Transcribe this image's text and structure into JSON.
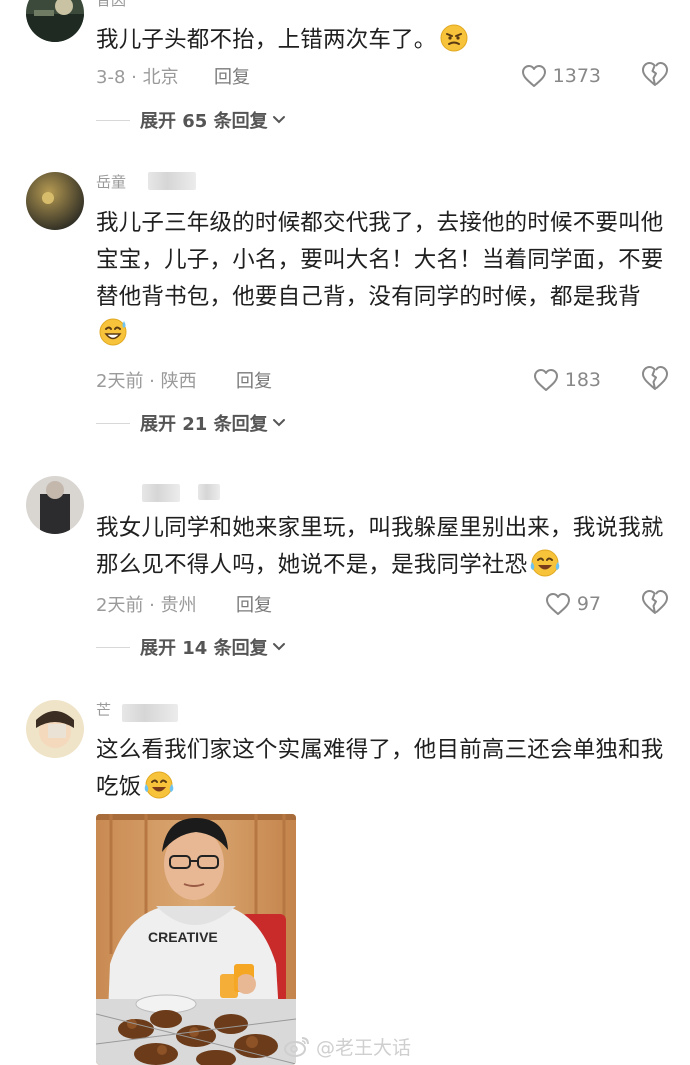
{
  "comments": [
    {
      "username": "昔因",
      "text": "我儿子头都不抬，上错两次车了。",
      "emoji": "angry-emoji",
      "date_location": "3-8 · 北京",
      "reply_label": "回复",
      "likes": "1373",
      "expand_label": "展开 65 条回复"
    },
    {
      "username": "岳童",
      "text": "我儿子三年级的时候都交代我了，去接他的时候不要叫他宝宝，儿子，小名，要叫大名！大名！当着同学面，不要替他背书包，他要自己背，没有同学的时候，都是我背",
      "emoji": "laughing-sweat-emoji",
      "date_location": "2天前 · 陕西",
      "reply_label": "回复",
      "likes": "183",
      "expand_label": "展开 21 条回复"
    },
    {
      "username": "",
      "text": "我女儿同学和她来家里玩，叫我躲屋里别出来，我说我就那么见不得人吗，她说不是，是我同学社恐",
      "emoji": "tears-of-joy-emoji",
      "date_location": "2天前 · 贵州",
      "reply_label": "回复",
      "likes": "97",
      "expand_label": "展开 14 条回复"
    },
    {
      "username": "芒",
      "text": "这么看我们家这个实属难得了，他目前高三还会单独和我吃饭",
      "emoji": "tears-of-joy-emoji"
    }
  ],
  "photo": {
    "shirt_text": "CREATIVE"
  },
  "watermark": {
    "text": "@老王大话"
  },
  "colors": {
    "text": "#1f1f1f",
    "meta": "#9a9a9a",
    "emoji_yellow": "#f7c33b"
  },
  "icons": {
    "like": "heart-outline-icon",
    "dislike": "broken-heart-icon",
    "expand": "chevron-down-icon"
  }
}
